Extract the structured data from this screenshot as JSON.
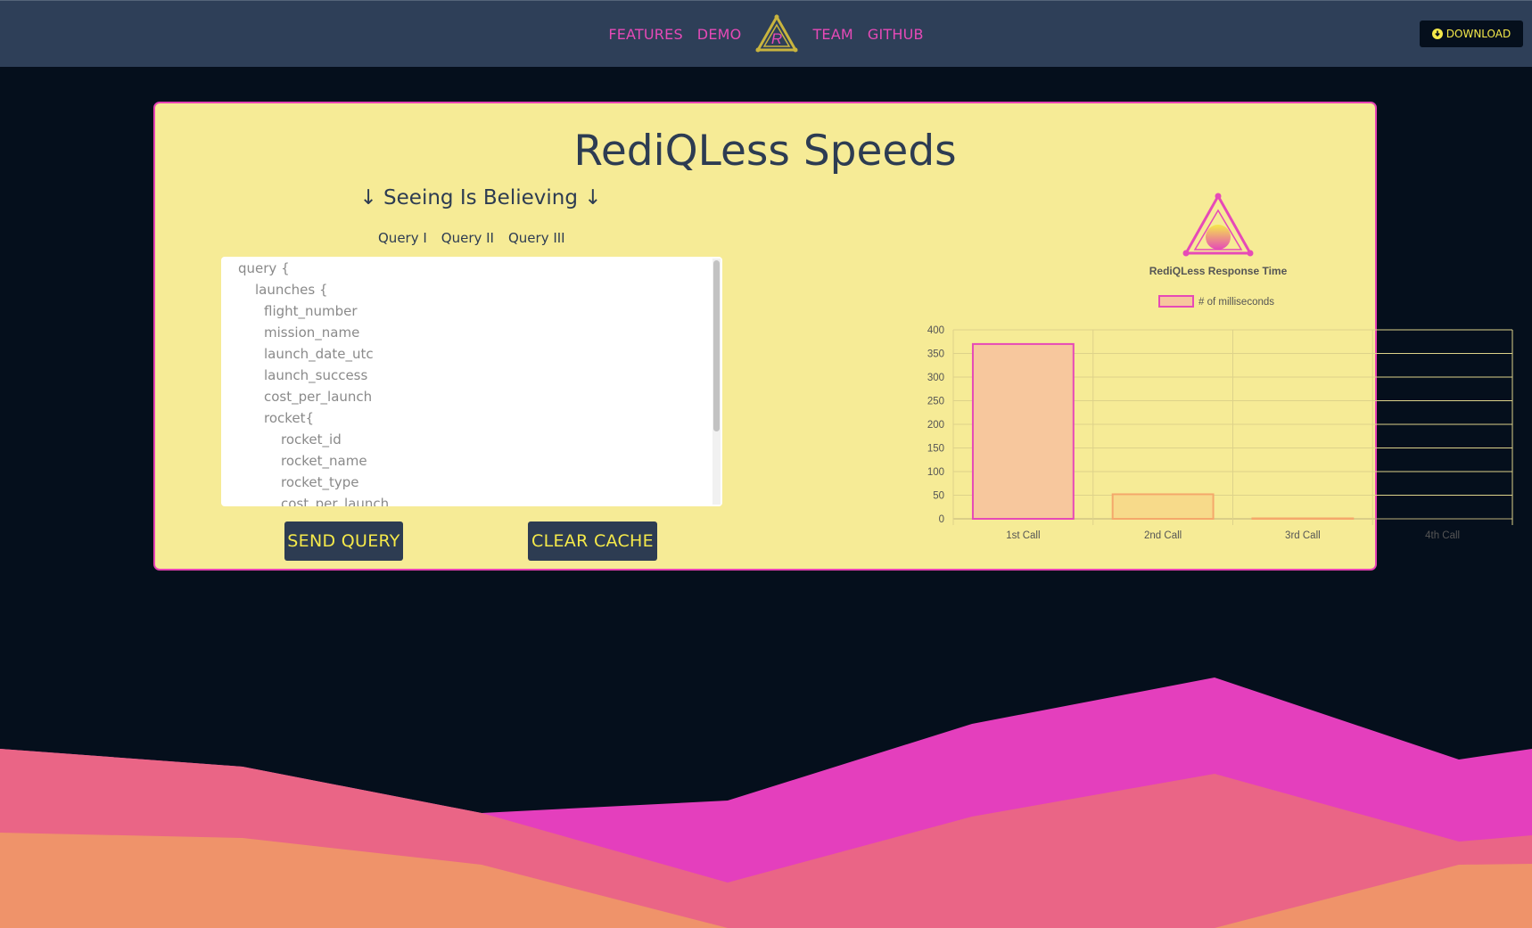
{
  "nav": {
    "features": "FEATURES",
    "demo": "DEMO",
    "logo_letter": "R",
    "team": "TEAM",
    "github": "GITHUB",
    "download": "DOWNLOAD"
  },
  "card": {
    "title": "RediQLess Speeds",
    "subtitle": "↓ Seeing Is Believing ↓",
    "query_tabs": [
      "Query I",
      "Query II",
      "Query III"
    ],
    "editor_lines": [
      "query {",
      "launches {",
      "flight_number",
      "mission_name",
      "launch_date_utc",
      "launch_success",
      "cost_per_launch",
      "rocket{",
      "rocket_id",
      "rocket_name",
      "rocket_type",
      "cost_per_launch"
    ],
    "send_button": "SEND QUERY",
    "clear_button": "CLEAR CACHE"
  },
  "colors": {
    "accent": "#e64ab7",
    "card_bg": "#f6eb96",
    "dark": "#2d3c52",
    "yellow": "#f5e94a"
  },
  "chart_data": {
    "type": "bar",
    "title": "RediQLess Response Time",
    "categories": [
      "1st Call",
      "2nd Call",
      "3rd Call",
      "4th Call"
    ],
    "series": [
      {
        "name": "# of milliseconds",
        "values": [
          370,
          52,
          1,
          0
        ]
      }
    ],
    "ylim": [
      0,
      400
    ],
    "yticks": [
      0,
      50,
      100,
      150,
      200,
      250,
      300,
      350,
      400
    ],
    "legend": "top",
    "grid": true
  }
}
